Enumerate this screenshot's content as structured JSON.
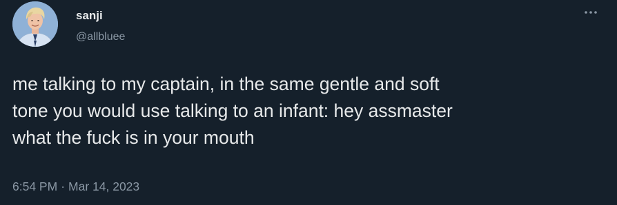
{
  "user": {
    "display_name": "sanji",
    "handle": "@allbluee"
  },
  "tweet": {
    "lines": [
      "me talking to my captain, in the same gentle and soft",
      "tone you would use talking to an infant: hey assmaster",
      "what the fuck is in your mouth"
    ],
    "time": "6:54 PM",
    "separator": "·",
    "date": "Mar 14, 2023"
  },
  "icons": {
    "more": "more-horizontal-icon",
    "avatar": "avatar"
  },
  "colors": {
    "background": "#15202b",
    "text": "#e7e9ea",
    "secondary_text": "#8b98a5"
  }
}
